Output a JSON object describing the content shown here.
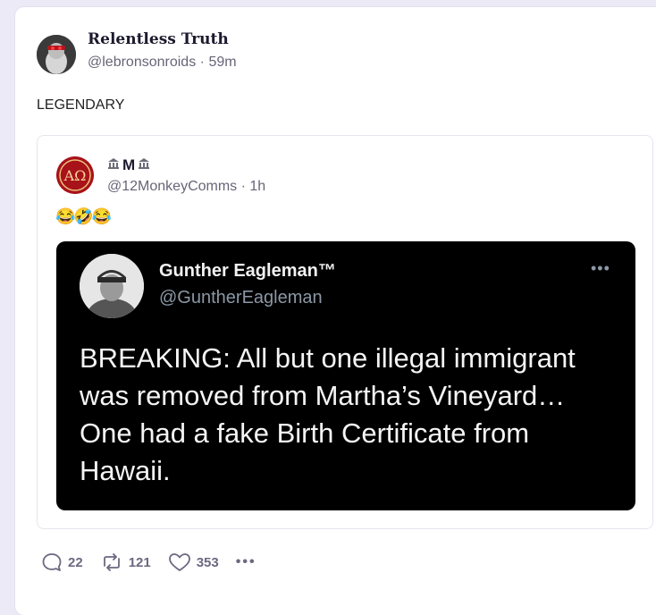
{
  "post": {
    "author_name": "Relentless Truth",
    "author_handle": "@lebronsonroids",
    "time": "59m",
    "text": "LEGENDARY"
  },
  "quote": {
    "author_name": "M",
    "author_name_icons": [
      "bank-icon",
      "bank-icon"
    ],
    "author_handle": "@12MonkeyComms",
    "time": "1h",
    "text": "😂🤣😂"
  },
  "embedded_tweet": {
    "author_name": "Gunther Eagleman™",
    "author_handle": "@GuntherEagleman",
    "more": "•••",
    "body": "BREAKING: All but one illegal immigrant was removed from Martha’s Vineyard… One had a fake Birth Certificate from Hawaii."
  },
  "actions": {
    "replies": "22",
    "reposts": "121",
    "likes": "353",
    "more": "•••"
  },
  "colors": {
    "accent": "#6b6880",
    "background": "#eceaf6",
    "embedded_background": "#000000"
  }
}
